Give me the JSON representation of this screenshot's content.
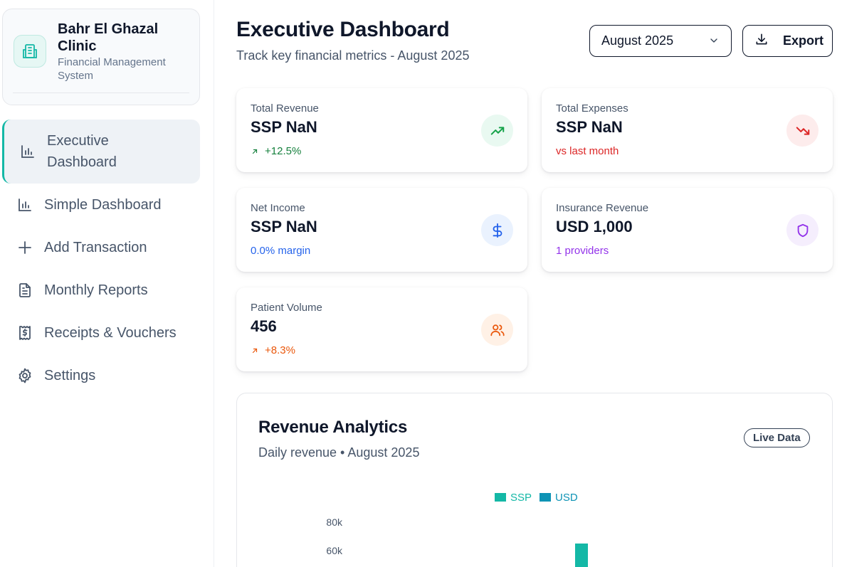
{
  "brand": {
    "name": "Bahr El Ghazal Clinic",
    "subtitle": "Financial Management System"
  },
  "nav": [
    {
      "label": "Executive Dashboard",
      "icon": "bar-chart-icon",
      "active": true
    },
    {
      "label": "Simple Dashboard",
      "icon": "bar-chart-icon",
      "active": false
    },
    {
      "label": "Add Transaction",
      "icon": "plus-icon",
      "active": false
    },
    {
      "label": "Monthly Reports",
      "icon": "document-icon",
      "active": false
    },
    {
      "label": "Receipts & Vouchers",
      "icon": "receipt-icon",
      "active": false
    },
    {
      "label": "Settings",
      "icon": "gear-icon",
      "active": false
    }
  ],
  "header": {
    "title": "Executive Dashboard",
    "subtitle": "Track key financial metrics - August 2025",
    "month_selected": "August 2025",
    "export_label": "Export"
  },
  "cards": [
    {
      "label": "Total Revenue",
      "value": "SSP NaN",
      "note": "+12.5%",
      "note_color": "#15803d",
      "icon": "trend-up-icon",
      "icon_bg": "#e9f9f1",
      "icon_color": "#16a34a"
    },
    {
      "label": "Total Expenses",
      "value": "SSP NaN",
      "note": "vs last month",
      "note_color": "#dc2626",
      "icon": "trend-down-icon",
      "icon_bg": "#fdecec",
      "icon_color": "#dc2626"
    },
    {
      "label": "Net Income",
      "value": "SSP NaN",
      "note": "0.0% margin",
      "note_color": "#2563eb",
      "icon": "dollar-icon",
      "icon_bg": "#eaf2fe",
      "icon_color": "#2563eb"
    },
    {
      "label": "Insurance Revenue",
      "value": "USD 1,000",
      "note": "1 providers",
      "note_color": "#9333ea",
      "icon": "shield-icon",
      "icon_bg": "#f5eefd",
      "icon_color": "#9333ea"
    },
    {
      "label": "Patient Volume",
      "value": "456",
      "note": "+8.3%",
      "note_color": "#ea580c",
      "icon": "users-icon",
      "icon_bg": "#fff1e6",
      "icon_color": "#ea580c"
    }
  ],
  "analytics": {
    "title": "Revenue Analytics",
    "subtitle": "Daily revenue • August 2025",
    "badge": "Live Data"
  },
  "chart_data": {
    "type": "bar",
    "series": [
      {
        "name": "SSP",
        "color": "#14b8a6"
      },
      {
        "name": "USD",
        "color": "#0e93b5"
      }
    ],
    "y_tick_labels": [
      "80k",
      "60k"
    ],
    "ylim": [
      0,
      80000
    ],
    "visible_bar": {
      "series": "SSP",
      "value_min": 65000
    }
  }
}
